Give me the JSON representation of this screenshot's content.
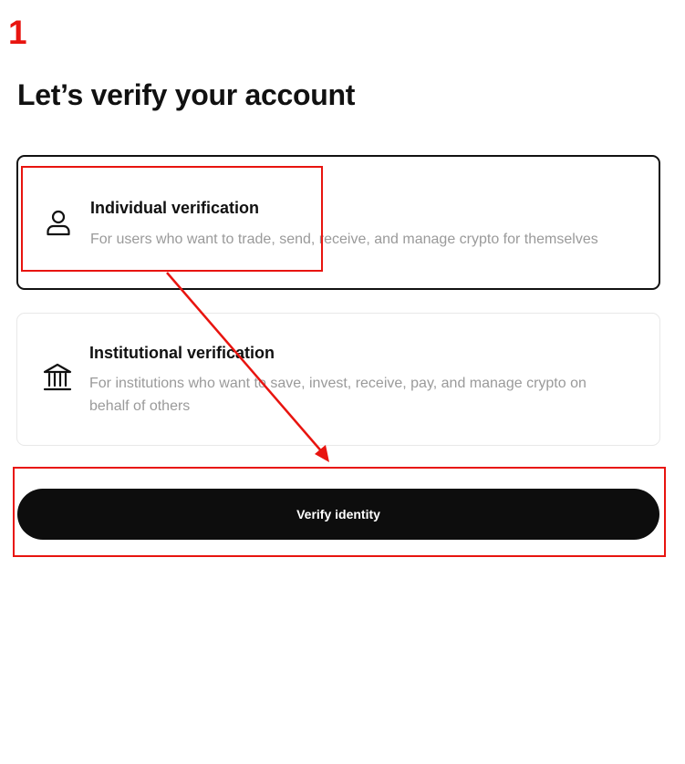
{
  "step_number": "1",
  "page_title": "Let’s verify your account",
  "options": [
    {
      "title": "Individual verification",
      "description": "For users who want to trade, send, receive, and manage crypto for themselves",
      "icon": "user-icon",
      "selected": true
    },
    {
      "title": "Institutional verification",
      "description": "For institutions who want to save, invest, receive, pay, and manage crypto on behalf of others",
      "icon": "bank-icon",
      "selected": false
    }
  ],
  "verify_button_label": "Verify identity",
  "colors": {
    "annotation": "#e8140f",
    "button_bg": "#0d0d0d",
    "button_text": "#ffffff",
    "description_text": "#9a9a9a",
    "selected_border": "#111111",
    "unselected_border": "#e8e8e8"
  }
}
